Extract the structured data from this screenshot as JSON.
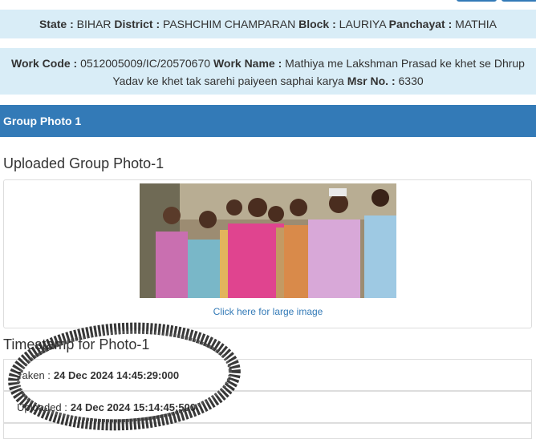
{
  "location": {
    "state_label": "State :",
    "state": "BIHAR",
    "district_label": "District :",
    "district": "PASHCHIM CHAMPARAN",
    "block_label": "Block :",
    "block": "LAURIYA",
    "panchayat_label": "Panchayat :",
    "panchayat": "MATHIA"
  },
  "work": {
    "code_label": "Work Code :",
    "code": "0512005009/IC/20570670",
    "name_label": "Work Name :",
    "name": "Mathiya me Lakshman Prasad ke khet se Dhrup Yadav ke khet tak sarehi paiyeen saphai karya",
    "msr_label": "Msr No. :",
    "msr": "6330"
  },
  "group_header": "Group Photo 1",
  "uploaded_heading": "Uploaded Group Photo-1",
  "large_image_link": "Click here for large image",
  "timestamp_heading": "Timestamp for Photo-1",
  "timestamps": {
    "taken_label": "Taken :",
    "taken": "24 Dec 2024 14:45:29:000",
    "uploaded_label": "Uploaded :",
    "uploaded": "24 Dec 2024 15:14:45:500"
  },
  "colors": {
    "primary": "#337ab7",
    "info_band": "#d9edf7",
    "scribble": "#222222"
  }
}
